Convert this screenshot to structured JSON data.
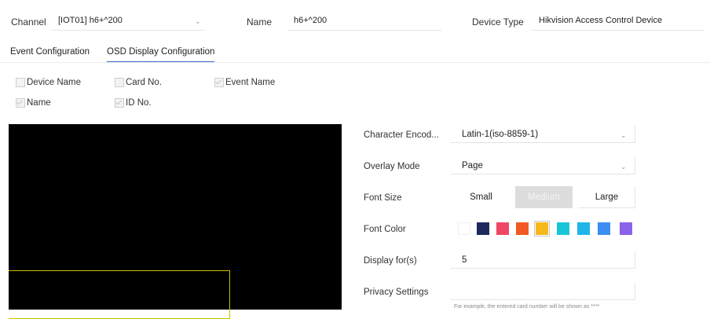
{
  "header": {
    "channel_label": "Channel",
    "channel_value": "[IOT01] h6+^200",
    "name_label": "Name",
    "name_value": "h6+^200",
    "device_type_label": "Device Type",
    "device_type_value": "Hikvision Access Control Device"
  },
  "tabs": [
    {
      "label": "Event Configuration",
      "active": false
    },
    {
      "label": "OSD Display Configuration",
      "active": true
    }
  ],
  "osd_fields": [
    {
      "label": "Device Name",
      "checked": false
    },
    {
      "label": "Card No.",
      "checked": false
    },
    {
      "label": "Event Name",
      "checked": true
    },
    {
      "label": "Name",
      "checked": true
    },
    {
      "label": "ID No.",
      "checked": true
    }
  ],
  "settings": {
    "character_encoding_label": "Character Encod...",
    "character_encoding_value": "Latin-1(iso-8859-1)",
    "overlay_mode_label": "Overlay Mode",
    "overlay_mode_value": "Page",
    "font_size_label": "Font Size",
    "font_size_options": [
      "Small",
      "Medium",
      "Large"
    ],
    "font_size_selected": "Medium",
    "font_color_label": "Font Color",
    "font_colors": [
      "#ffffff",
      "#1f2a5c",
      "#ef4765",
      "#f15a22",
      "#f6b81a",
      "#16c6d8",
      "#1fb5e8",
      "#3c8ef0",
      "#8a63e8"
    ],
    "font_color_selected_index": 4,
    "display_for_label": "Display for(s)",
    "display_for_value": "5",
    "privacy_settings_label": "Privacy Settings",
    "privacy_hint": "For example, the entered card number will be shown as ****"
  },
  "colors": {
    "accent": "#3d6fc0",
    "preview_bg": "#000000",
    "osd_box_border": "#c8c000"
  }
}
